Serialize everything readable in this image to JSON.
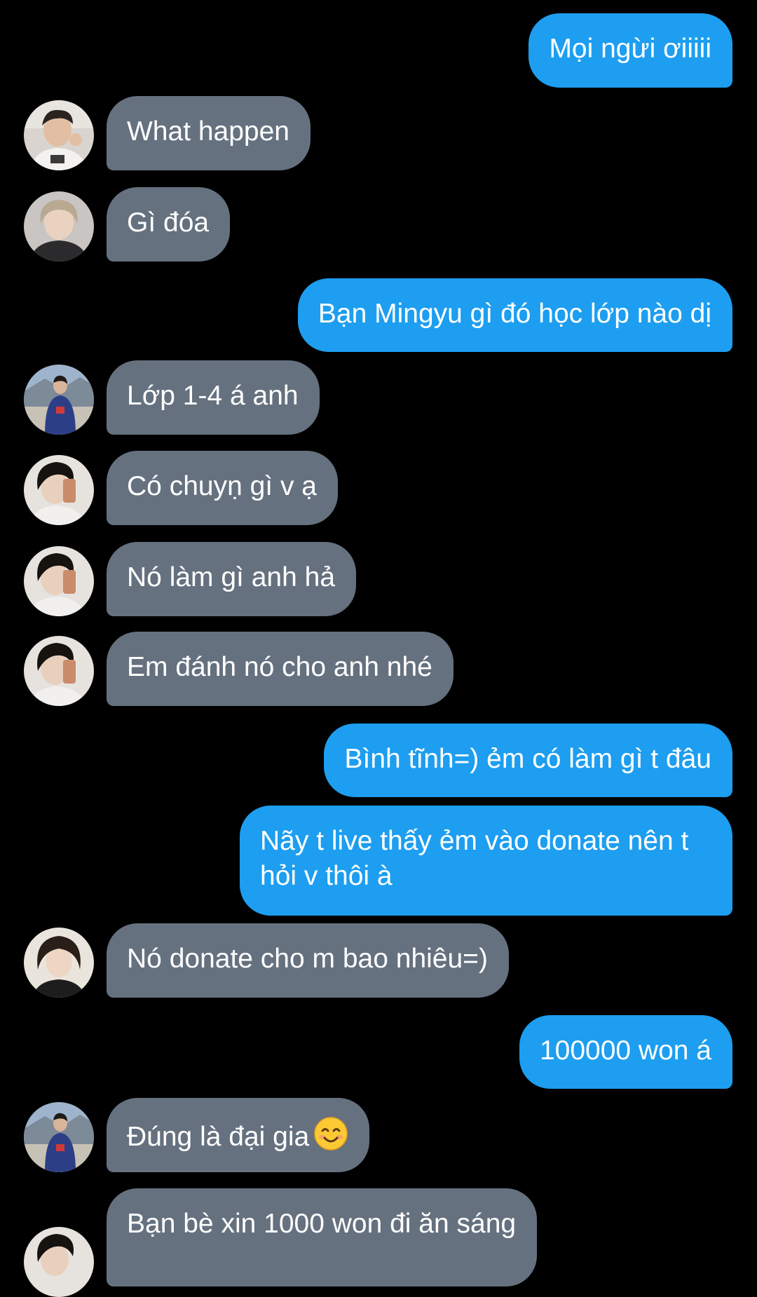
{
  "chat": {
    "messages": [
      {
        "text": "Mọi ngừi ơiiiii"
      },
      {
        "text": "What happen"
      },
      {
        "text": "Gì đóa"
      },
      {
        "text": "Bạn Mingyu gì đó học lớp nào dị"
      },
      {
        "text": "Lớp 1-4 á anh"
      },
      {
        "text": "Có chuyṇ gì v ạ"
      },
      {
        "text": "Nó làm gì anh hả"
      },
      {
        "text": "Em đánh nó cho anh nhé"
      },
      {
        "text": "Bình tĩnh=) ẻm có làm gì t đâu"
      },
      {
        "text": "Nãy t live thấy ẻm vào donate nên t hỏi v thôi à"
      },
      {
        "text": "Nó donate cho m bao nhiêu=)"
      },
      {
        "text": "100000 won á"
      },
      {
        "text": "Đúng là đại gia",
        "emoji": "smiling-face-emoji"
      },
      {
        "text": "Bạn bè xin 1000 won đi ăn sáng"
      }
    ]
  },
  "colors": {
    "background": "#000000",
    "outgoing_bubble": "#1d9ef0",
    "incoming_bubble": "#66717f",
    "text": "#ffffff"
  }
}
